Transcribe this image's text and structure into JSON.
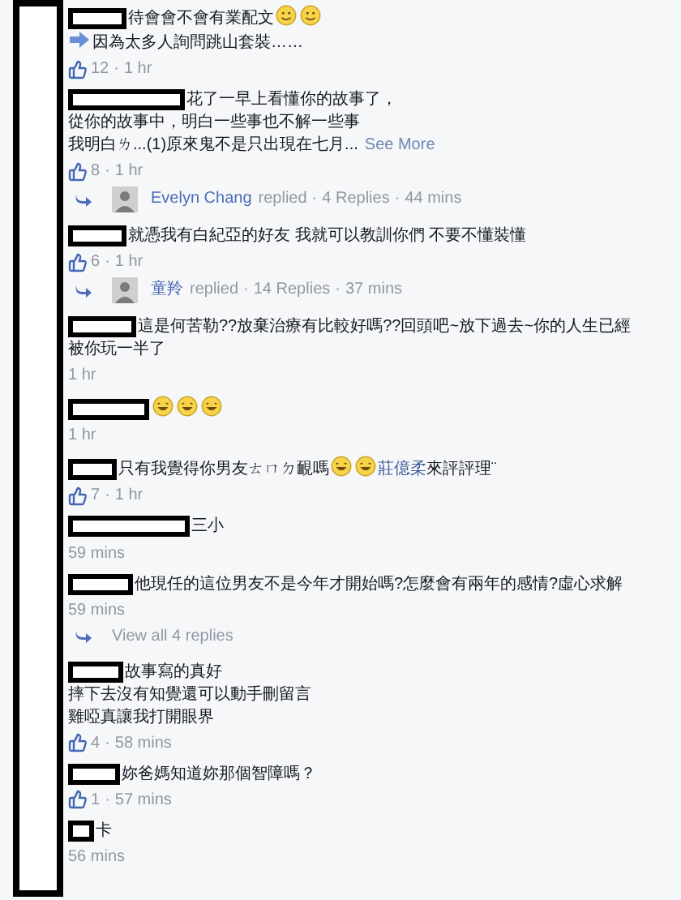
{
  "separator": "·",
  "comments": [
    {
      "lines": [
        [
          {
            "kind": "text",
            "text": "待會會不會有業配文"
          },
          {
            "kind": "smiley"
          },
          {
            "kind": "smiley"
          }
        ],
        [
          {
            "kind": "arrow"
          },
          {
            "kind": "text",
            "text": "因為太多人詢問跳山套裝……"
          }
        ]
      ],
      "likes": "12",
      "time": "1 hr"
    },
    {
      "lines": [
        [
          {
            "kind": "text",
            "text": "花了一早上看懂你的故事了，"
          }
        ],
        [
          {
            "kind": "text",
            "text": "從你的故事中，明白一些事也不解一些事"
          }
        ],
        [
          {
            "kind": "text",
            "text": "我明白ㄌ...(1)原來鬼不是只出現在七月..."
          },
          {
            "kind": "link",
            "text": "See More"
          }
        ]
      ],
      "likes": "8",
      "time": "1 hr",
      "reply": {
        "name": "Evelyn Chang",
        "action": "replied",
        "count": "4 Replies",
        "time": "44 mins"
      }
    },
    {
      "lines": [
        [
          {
            "kind": "text",
            "text": "就憑我有白紀亞的好友 我就可以教訓你們 不要不懂裝懂"
          }
        ]
      ],
      "likes": "6",
      "time": "1 hr",
      "reply": {
        "name": "童羚",
        "action": "replied",
        "count": "14 Replies",
        "time": "37 mins"
      }
    },
    {
      "lines": [
        [
          {
            "kind": "text",
            "text": "這是何苦勒??放棄治療有比較好嗎??回頭吧~放下過去~你的人生已經"
          }
        ],
        [
          {
            "kind": "text",
            "text": "被你玩一半了"
          }
        ]
      ],
      "time": "1 hr"
    },
    {
      "lines": [
        [
          {
            "kind": "laugh"
          },
          {
            "kind": "laugh"
          },
          {
            "kind": "laugh"
          }
        ]
      ],
      "time": "1 hr"
    },
    {
      "lines": [
        [
          {
            "kind": "text",
            "text": "只有我覺得你男友ㄊㄇㄉ靦嗎"
          },
          {
            "kind": "laugh"
          },
          {
            "kind": "laugh"
          },
          {
            "kind": "mention",
            "text": "莊億柔"
          },
          {
            "kind": "text",
            "text": "來評評理¨"
          }
        ]
      ],
      "likes": "7",
      "time": "1 hr"
    },
    {
      "lines": [
        [
          {
            "kind": "text",
            "text": "三小"
          }
        ]
      ],
      "time": "59 mins"
    },
    {
      "lines": [
        [
          {
            "kind": "text",
            "text": "他現任的這位男友不是今年才開始嗎?怎麼會有兩年的感情?虛心求解"
          }
        ]
      ],
      "time": "59 mins",
      "view_replies": "View all 4 replies"
    },
    {
      "lines": [
        [
          {
            "kind": "text",
            "text": "故事寫的真好"
          }
        ],
        [
          {
            "kind": "text",
            "text": "摔下去沒有知覺還可以動手刪留言"
          }
        ],
        [
          {
            "kind": "text",
            "text": "雞啞真讓我打開眼界"
          }
        ]
      ],
      "likes": "4",
      "time": "58 mins"
    },
    {
      "lines": [
        [
          {
            "kind": "text",
            "text": "妳爸媽知道妳那個智障嗎？"
          }
        ]
      ],
      "likes": "1",
      "time": "57 mins"
    },
    {
      "lines": [
        [
          {
            "kind": "text",
            "text": "卡"
          }
        ]
      ],
      "time": "56 mins"
    }
  ]
}
